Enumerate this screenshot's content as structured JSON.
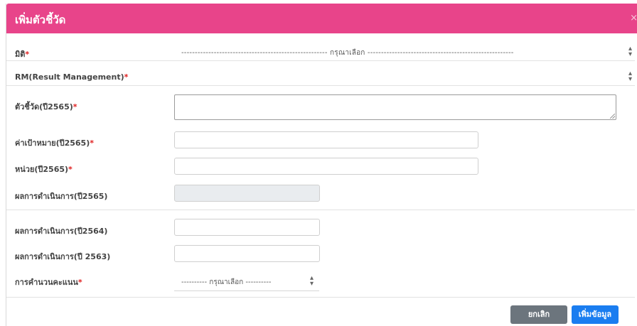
{
  "modal": {
    "title": "เพิ่มตัวชี้วัด",
    "close": "×"
  },
  "form": {
    "dimension": {
      "label": "มิติ",
      "required": "*",
      "selected": "------------------------------------------------------ กรุณาเลือก ------------------------------------------------------",
      "arrow": "⬍"
    },
    "rm": {
      "label": "RM(Result Management)",
      "required": "*",
      "selected": "",
      "arrow": "⬍"
    },
    "indicator": {
      "label": "ตัวชี้วัด(ปี2565)",
      "required": "*",
      "value": ""
    },
    "target": {
      "label": "ค่าเป้าหมาย(ปี2565)",
      "required": "*",
      "value": ""
    },
    "unit": {
      "label": "หน่วย(ปี2565)",
      "required": "*",
      "value": ""
    },
    "result_2565": {
      "label": "ผลการดำเนินการ(ปี2565)",
      "value": ""
    },
    "result_2564": {
      "label": "ผลการดำเนินการ(ปี2564)",
      "value": ""
    },
    "result_2563": {
      "label": "ผลการดำเนินการ(ปี 2563)",
      "value": ""
    },
    "scoring": {
      "label": "การคำนวนคะแนน",
      "required": "*",
      "selected": "---------- กรุณาเลือก ----------",
      "arrow": "⬍"
    }
  },
  "buttons": {
    "cancel": "ยกเลิก",
    "submit": "เพิ่มข้อมูล"
  },
  "colors": {
    "header": "#e8448a",
    "cancel": "#6c757d",
    "submit": "#1a7df0",
    "required": "#e02020"
  }
}
